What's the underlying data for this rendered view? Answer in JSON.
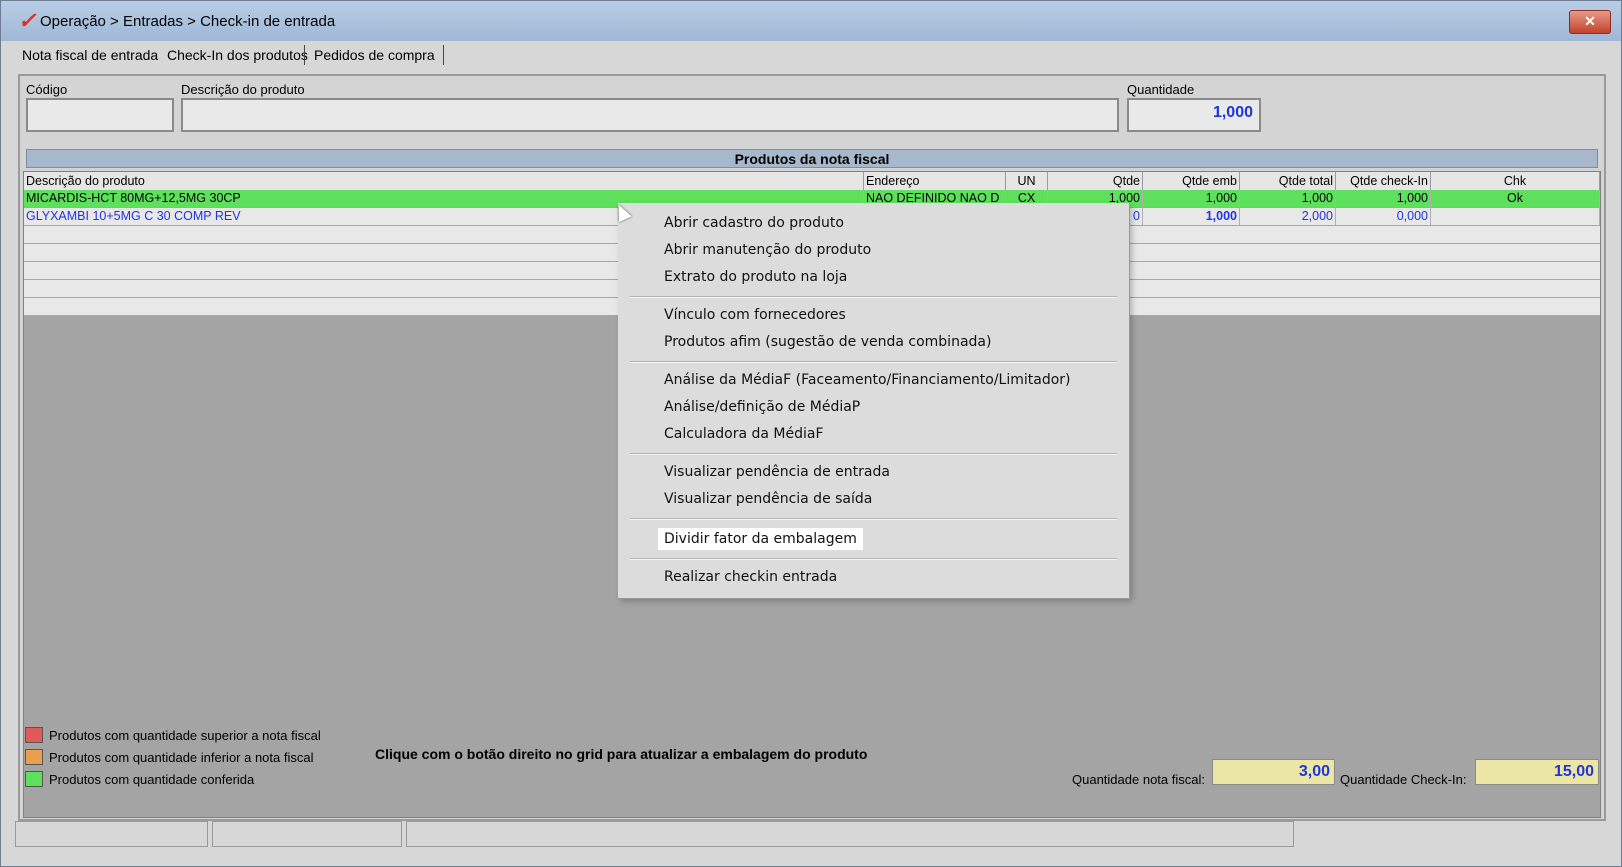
{
  "window": {
    "title": "Operação > Entradas > Check-in de entrada",
    "close_label": "✕"
  },
  "tabs": [
    "Nota fiscal de entrada",
    "Check-In dos produtos",
    "Pedidos de compra"
  ],
  "form": {
    "codigo_label": "Código",
    "codigo_value": "",
    "descricao_label": "Descrição do produto",
    "descricao_value": "",
    "quantidade_label": "Quantidade",
    "quantidade_value": "1,000"
  },
  "panel_title": "Produtos da nota fiscal",
  "grid": {
    "columns": [
      "Descrição do produto",
      "Endereço",
      "UN",
      "Qtde",
      "Qtde emb",
      "Qtde total",
      "Qtde check-In",
      "Chk"
    ],
    "rows": [
      {
        "descricao": "MICARDIS-HCT 80MG+12,5MG 30CP",
        "endereco": "NAO DEFINIDO NAO D",
        "un": "CX",
        "qtde": "1,000",
        "qtde_emb": "1,000",
        "qtde_total": "1,000",
        "qtde_checkin": "1,000",
        "chk": "Ok",
        "status": "conferida"
      },
      {
        "descricao": "GLYXAMBI 10+5MG C 30 COMP REV",
        "endereco": "",
        "un": "",
        "qtde": "0",
        "qtde_emb": "1,000",
        "qtde_total": "2,000",
        "qtde_checkin": "0,000",
        "chk": "",
        "status": "none"
      }
    ]
  },
  "context_menu": {
    "groups": [
      [
        "Abrir cadastro do produto",
        "Abrir manutenção do produto",
        "Extrato do produto na loja"
      ],
      [
        "Vínculo com fornecedores",
        "Produtos afim (sugestão de venda combinada)"
      ],
      [
        "Análise da MédiaF (Faceamento/Financiamento/Limitador)",
        "Análise/definição de MédiaP",
        "Calculadora da MédiaF"
      ],
      [
        "Visualizar pendência de entrada",
        "Visualizar pendência de saída"
      ],
      [
        "Dividir fator da embalagem"
      ],
      [
        "Realizar checkin entrada"
      ]
    ],
    "highlighted": "Dividir fator da embalagem"
  },
  "legend": [
    {
      "label": "Produtos com quantidade superior a nota fiscal",
      "color": "#e05a5a"
    },
    {
      "label": "Produtos com quantidade inferior a nota fiscal",
      "color": "#e9a04e"
    },
    {
      "label": "Produtos com quantidade conferida",
      "color": "#5fe05d"
    }
  ],
  "hint": "Clique com o botão direito no grid para atualizar a embalagem do produto",
  "totals": {
    "nota_fiscal_label": "Quantidade nota fiscal:",
    "nota_fiscal_value": "3,00",
    "checkin_label": "Quantidade Check-In:",
    "checkin_value": "15,00"
  },
  "colors": {
    "accent_blue": "#1f35d8",
    "row_ok_green": "#5fe05d",
    "titlebar": "#a8c0dc"
  }
}
